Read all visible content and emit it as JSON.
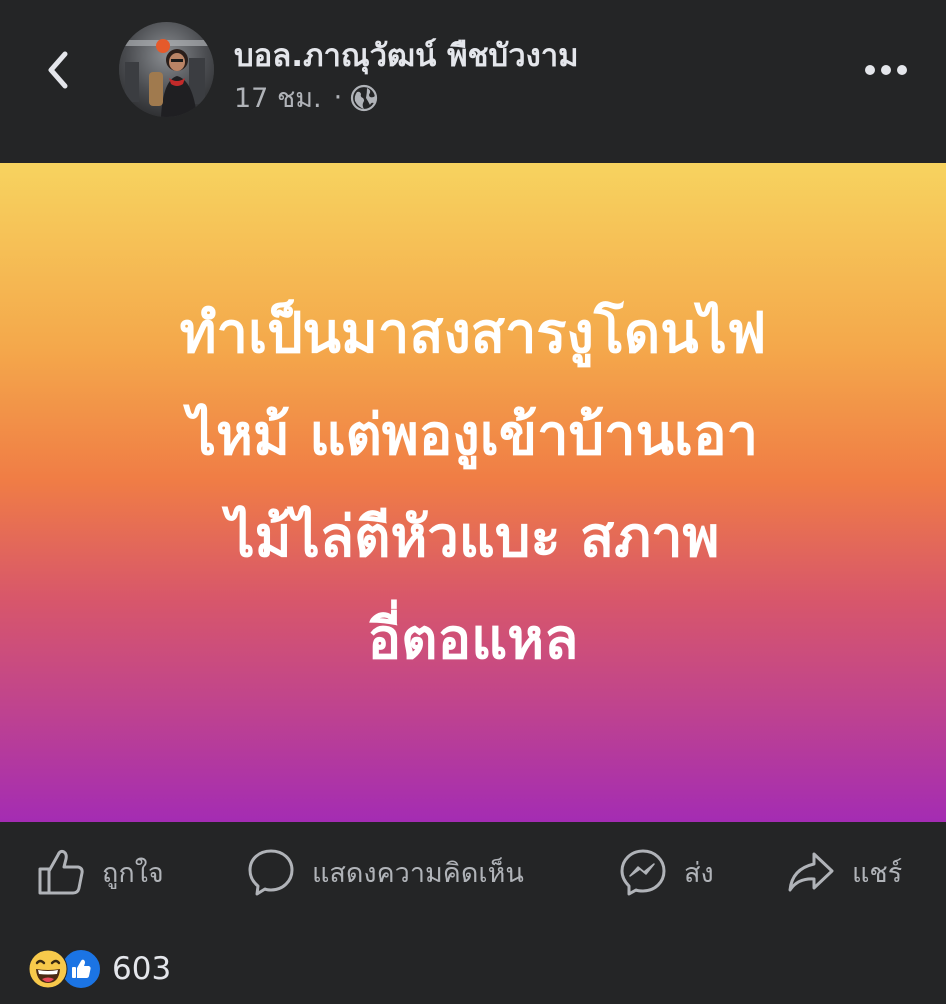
{
  "header": {
    "author_name": "บอล.ภาณุวัฒน์ พืชบัวงาม",
    "timestamp": "17 ชม.",
    "separator": "·",
    "privacy_icon": "globe-icon",
    "back_icon": "chevron-left-icon",
    "more_icon": "more-dots-icon"
  },
  "post": {
    "lines": [
      "ทำเป็นมาสงสารงูโดนไฟ",
      "ไหม้ แต่พองูเข้าบ้านเอา",
      "ไม้ไล่ตีหัวแบะ สภาพ",
      "อี่ตอแหล"
    ],
    "background_gradient": [
      "#f7d35f",
      "#f07d45",
      "#a42cb3"
    ]
  },
  "actions": {
    "like_label": "ถูกใจ",
    "comment_label": "แสดงความคิดเห็น",
    "send_label": "ส่ง",
    "share_label": "แชร์"
  },
  "reactions": {
    "icons": [
      "laughing-emoji-icon",
      "like-thumb-icon"
    ],
    "count": "603"
  },
  "colors": {
    "background": "#242526",
    "primary_text": "#e4e6eb",
    "secondary_text": "#b0b3b8",
    "like_blue": "#1b74e4"
  }
}
